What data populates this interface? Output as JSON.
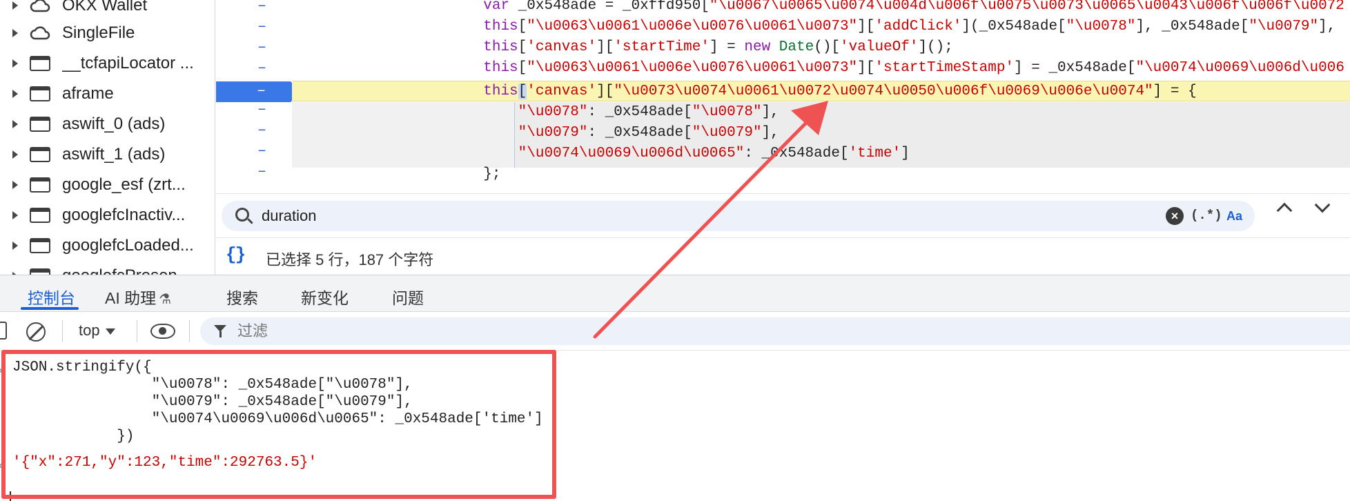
{
  "tree": {
    "items": [
      {
        "label": "OKX Wallet",
        "icon": "cloud-icon"
      },
      {
        "label": "SingleFile",
        "icon": "cloud-icon"
      },
      {
        "label": "__tcfapiLocator ...",
        "icon": "frame-icon"
      },
      {
        "label": "aframe",
        "icon": "frame-icon"
      },
      {
        "label": "aswift_0 (ads)",
        "icon": "frame-icon"
      },
      {
        "label": "aswift_1 (ads)",
        "icon": "frame-icon"
      },
      {
        "label": "google_esf (zrt...",
        "icon": "frame-icon"
      },
      {
        "label": "googlefcInactiv...",
        "icon": "frame-icon"
      },
      {
        "label": "googlefcLoaded...",
        "icon": "frame-icon"
      },
      {
        "label": "googlefcPresen...",
        "icon": "frame-icon"
      }
    ]
  },
  "editor": {
    "gutter_mark": "–",
    "lines": [
      {
        "indent": "",
        "parts": [
          [
            "kw",
            "var "
          ],
          [
            "id",
            "_0x548ade = _0xffd950["
          ],
          [
            "str",
            "\"\\u0067\\u0065\\u0074\\u004d\\u006f\\u0075\\u0073\\u0065\\u0043\\u006f\\u006f\\u0072"
          ]
        ]
      },
      {
        "indent": "",
        "parts": [
          [
            "kw",
            "this"
          ],
          [
            "id",
            "["
          ],
          [
            "str",
            "\"\\u0063\\u0061\\u006e\\u0076\\u0061\\u0073\""
          ],
          [
            "id",
            "]["
          ],
          [
            "str",
            "'addClick'"
          ],
          [
            "id",
            "](_0x548ade["
          ],
          [
            "str",
            "\"\\u0078\""
          ],
          [
            "id",
            "], _0x548ade["
          ],
          [
            "str",
            "\"\\u0079\""
          ],
          [
            "id",
            "],"
          ]
        ]
      },
      {
        "indent": "",
        "parts": [
          [
            "kw",
            "this"
          ],
          [
            "id",
            "["
          ],
          [
            "str",
            "'canvas'"
          ],
          [
            "id",
            "]["
          ],
          [
            "str",
            "'startTime'"
          ],
          [
            "id",
            "] = "
          ],
          [
            "kw",
            "new "
          ],
          [
            "fn",
            "Date"
          ],
          [
            "id",
            "()["
          ],
          [
            "str",
            "'valueOf'"
          ],
          [
            "id",
            "]();"
          ]
        ]
      },
      {
        "indent": "",
        "parts": [
          [
            "kw",
            "this"
          ],
          [
            "id",
            "["
          ],
          [
            "str",
            "\"\\u0063\\u0061\\u006e\\u0076\\u0061\\u0073\""
          ],
          [
            "id",
            "]["
          ],
          [
            "str",
            "'startTimeStamp'"
          ],
          [
            "id",
            "] = _0x548ade["
          ],
          [
            "str",
            "\"\\u0074\\u0069\\u006d\\u006"
          ]
        ]
      },
      {
        "indent": "",
        "parts": [
          [
            "kw",
            "this"
          ],
          [
            "sel",
            "["
          ],
          [
            "str",
            "'canvas'"
          ],
          [
            "id",
            "]["
          ],
          [
            "str",
            "\"\\u0073\\u0074\\u0061\\u0072\\u0074\\u0050\\u006f\\u0069\\u006e\\u0074\""
          ],
          [
            "id",
            "] = {"
          ]
        ]
      },
      {
        "indent": "    ",
        "parts": [
          [
            "str",
            "\"\\u0078\""
          ],
          [
            "id",
            ": _0x548ade["
          ],
          [
            "str",
            "\"\\u0078\""
          ],
          [
            "id",
            "],"
          ]
        ]
      },
      {
        "indent": "    ",
        "parts": [
          [
            "str",
            "\"\\u0079\""
          ],
          [
            "id",
            ": _0x548ade["
          ],
          [
            "str",
            "\"\\u0079\""
          ],
          [
            "id",
            "],"
          ]
        ]
      },
      {
        "indent": "    ",
        "parts": [
          [
            "str",
            "\"\\u0074\\u0069\\u006d\\u0065\""
          ],
          [
            "id",
            ": _0x548ade["
          ],
          [
            "str",
            "'time'"
          ],
          [
            "id",
            "]"
          ]
        ]
      },
      {
        "indent": "",
        "parts": [
          [
            "id",
            "};"
          ]
        ]
      }
    ]
  },
  "search": {
    "value": "duration",
    "regex_label": "(.*)",
    "case_label": "Aa",
    "clear_label": "×"
  },
  "status": {
    "braces": "{}",
    "text": "已选择 5 行，187 个字符"
  },
  "tabs": [
    {
      "label": "控制台",
      "active": true
    },
    {
      "label": "AI 助理",
      "active": false
    },
    {
      "label": "搜索",
      "active": false
    },
    {
      "label": "新变化",
      "active": false
    },
    {
      "label": "问题",
      "active": false
    }
  ],
  "console_toolbar": {
    "context": "top",
    "filter_placeholder": "过滤"
  },
  "console": {
    "input_lines": [
      "JSON.stringify({",
      "                \"\\u0078\": _0x548ade[\"\\u0078\"],",
      "                \"\\u0079\": _0x548ade[\"\\u0079\"],",
      "                \"\\u0074\\u0069\\u006d\\u0065\": _0x548ade['time']",
      "            })"
    ],
    "result": "'{\"x\":271,\"y\":123,\"time\":292763.5}'"
  },
  "colors": {
    "annotation": "#ee5253",
    "accent": "#1a5fd4",
    "highlight": "#fbf5b4",
    "breakpoint": "#3b78e7"
  }
}
